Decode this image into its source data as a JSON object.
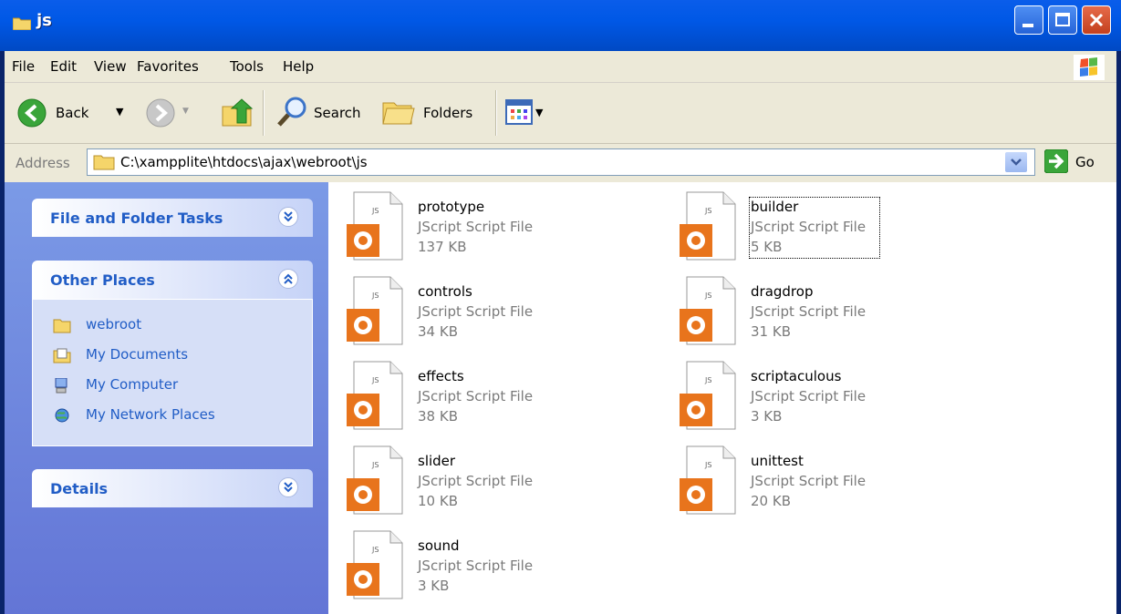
{
  "window": {
    "title": "js"
  },
  "menu": [
    "File",
    "Edit",
    "View",
    "Favorites",
    "Tools",
    "Help"
  ],
  "toolbar": {
    "back_label": "Back",
    "search_label": "Search",
    "folders_label": "Folders"
  },
  "address": {
    "label": "Address",
    "path": "C:\\xampplite\\htdocs\\ajax\\webroot\\js",
    "go_label": "Go"
  },
  "sidebar": {
    "tasks_title": "File and Folder Tasks",
    "other_title": "Other Places",
    "places": [
      "webroot",
      "My Documents",
      "My Computer",
      "My Network Places"
    ],
    "details_title": "Details"
  },
  "files": [
    {
      "name": "prototype",
      "type": "JScript Script File",
      "size": "137 KB"
    },
    {
      "name": "builder",
      "type": "JScript Script File",
      "size": "5 KB"
    },
    {
      "name": "controls",
      "type": "JScript Script File",
      "size": "34 KB"
    },
    {
      "name": "dragdrop",
      "type": "JScript Script File",
      "size": "31 KB"
    },
    {
      "name": "effects",
      "type": "JScript Script File",
      "size": "38 KB"
    },
    {
      "name": "scriptaculous",
      "type": "JScript Script File",
      "size": "3 KB"
    },
    {
      "name": "slider",
      "type": "JScript Script File",
      "size": "10 KB"
    },
    {
      "name": "unittest",
      "type": "JScript Script File",
      "size": "20 KB"
    },
    {
      "name": "sound",
      "type": "JScript Script File",
      "size": "3 KB"
    }
  ],
  "icon_text": "JS",
  "colors": {
    "titlebar": "#0058e6",
    "sidebar": "#6f8ae0",
    "link": "#215dc6",
    "file_icon_orange": "#e8741c"
  }
}
